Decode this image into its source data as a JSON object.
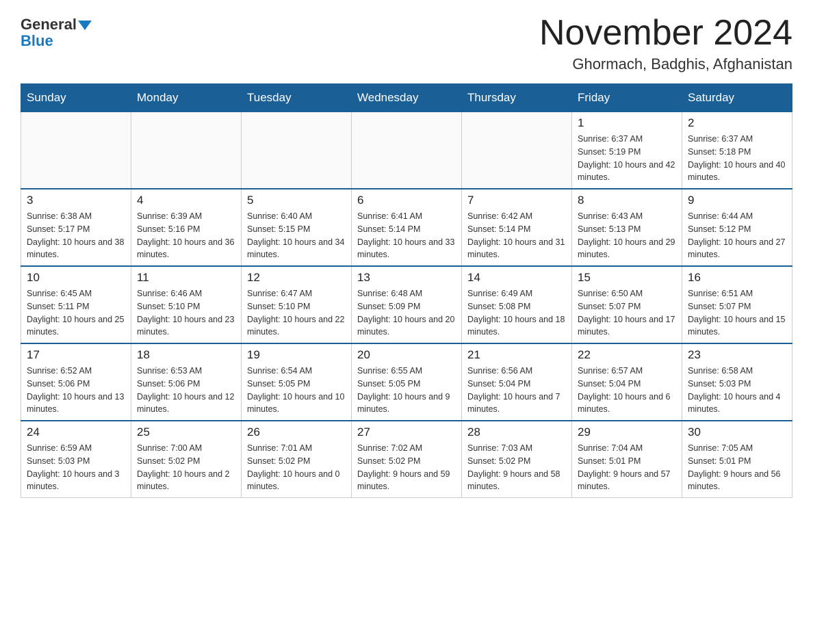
{
  "logo": {
    "part1": "General",
    "triangle": "▲",
    "part2": "Blue"
  },
  "title": "November 2024",
  "subtitle": "Ghormach, Badghis, Afghanistan",
  "days_of_week": [
    "Sunday",
    "Monday",
    "Tuesday",
    "Wednesday",
    "Thursday",
    "Friday",
    "Saturday"
  ],
  "weeks": [
    [
      {
        "day": "",
        "info": ""
      },
      {
        "day": "",
        "info": ""
      },
      {
        "day": "",
        "info": ""
      },
      {
        "day": "",
        "info": ""
      },
      {
        "day": "",
        "info": ""
      },
      {
        "day": "1",
        "info": "Sunrise: 6:37 AM\nSunset: 5:19 PM\nDaylight: 10 hours and 42 minutes."
      },
      {
        "day": "2",
        "info": "Sunrise: 6:37 AM\nSunset: 5:18 PM\nDaylight: 10 hours and 40 minutes."
      }
    ],
    [
      {
        "day": "3",
        "info": "Sunrise: 6:38 AM\nSunset: 5:17 PM\nDaylight: 10 hours and 38 minutes."
      },
      {
        "day": "4",
        "info": "Sunrise: 6:39 AM\nSunset: 5:16 PM\nDaylight: 10 hours and 36 minutes."
      },
      {
        "day": "5",
        "info": "Sunrise: 6:40 AM\nSunset: 5:15 PM\nDaylight: 10 hours and 34 minutes."
      },
      {
        "day": "6",
        "info": "Sunrise: 6:41 AM\nSunset: 5:14 PM\nDaylight: 10 hours and 33 minutes."
      },
      {
        "day": "7",
        "info": "Sunrise: 6:42 AM\nSunset: 5:14 PM\nDaylight: 10 hours and 31 minutes."
      },
      {
        "day": "8",
        "info": "Sunrise: 6:43 AM\nSunset: 5:13 PM\nDaylight: 10 hours and 29 minutes."
      },
      {
        "day": "9",
        "info": "Sunrise: 6:44 AM\nSunset: 5:12 PM\nDaylight: 10 hours and 27 minutes."
      }
    ],
    [
      {
        "day": "10",
        "info": "Sunrise: 6:45 AM\nSunset: 5:11 PM\nDaylight: 10 hours and 25 minutes."
      },
      {
        "day": "11",
        "info": "Sunrise: 6:46 AM\nSunset: 5:10 PM\nDaylight: 10 hours and 23 minutes."
      },
      {
        "day": "12",
        "info": "Sunrise: 6:47 AM\nSunset: 5:10 PM\nDaylight: 10 hours and 22 minutes."
      },
      {
        "day": "13",
        "info": "Sunrise: 6:48 AM\nSunset: 5:09 PM\nDaylight: 10 hours and 20 minutes."
      },
      {
        "day": "14",
        "info": "Sunrise: 6:49 AM\nSunset: 5:08 PM\nDaylight: 10 hours and 18 minutes."
      },
      {
        "day": "15",
        "info": "Sunrise: 6:50 AM\nSunset: 5:07 PM\nDaylight: 10 hours and 17 minutes."
      },
      {
        "day": "16",
        "info": "Sunrise: 6:51 AM\nSunset: 5:07 PM\nDaylight: 10 hours and 15 minutes."
      }
    ],
    [
      {
        "day": "17",
        "info": "Sunrise: 6:52 AM\nSunset: 5:06 PM\nDaylight: 10 hours and 13 minutes."
      },
      {
        "day": "18",
        "info": "Sunrise: 6:53 AM\nSunset: 5:06 PM\nDaylight: 10 hours and 12 minutes."
      },
      {
        "day": "19",
        "info": "Sunrise: 6:54 AM\nSunset: 5:05 PM\nDaylight: 10 hours and 10 minutes."
      },
      {
        "day": "20",
        "info": "Sunrise: 6:55 AM\nSunset: 5:05 PM\nDaylight: 10 hours and 9 minutes."
      },
      {
        "day": "21",
        "info": "Sunrise: 6:56 AM\nSunset: 5:04 PM\nDaylight: 10 hours and 7 minutes."
      },
      {
        "day": "22",
        "info": "Sunrise: 6:57 AM\nSunset: 5:04 PM\nDaylight: 10 hours and 6 minutes."
      },
      {
        "day": "23",
        "info": "Sunrise: 6:58 AM\nSunset: 5:03 PM\nDaylight: 10 hours and 4 minutes."
      }
    ],
    [
      {
        "day": "24",
        "info": "Sunrise: 6:59 AM\nSunset: 5:03 PM\nDaylight: 10 hours and 3 minutes."
      },
      {
        "day": "25",
        "info": "Sunrise: 7:00 AM\nSunset: 5:02 PM\nDaylight: 10 hours and 2 minutes."
      },
      {
        "day": "26",
        "info": "Sunrise: 7:01 AM\nSunset: 5:02 PM\nDaylight: 10 hours and 0 minutes."
      },
      {
        "day": "27",
        "info": "Sunrise: 7:02 AM\nSunset: 5:02 PM\nDaylight: 9 hours and 59 minutes."
      },
      {
        "day": "28",
        "info": "Sunrise: 7:03 AM\nSunset: 5:02 PM\nDaylight: 9 hours and 58 minutes."
      },
      {
        "day": "29",
        "info": "Sunrise: 7:04 AM\nSunset: 5:01 PM\nDaylight: 9 hours and 57 minutes."
      },
      {
        "day": "30",
        "info": "Sunrise: 7:05 AM\nSunset: 5:01 PM\nDaylight: 9 hours and 56 minutes."
      }
    ]
  ]
}
